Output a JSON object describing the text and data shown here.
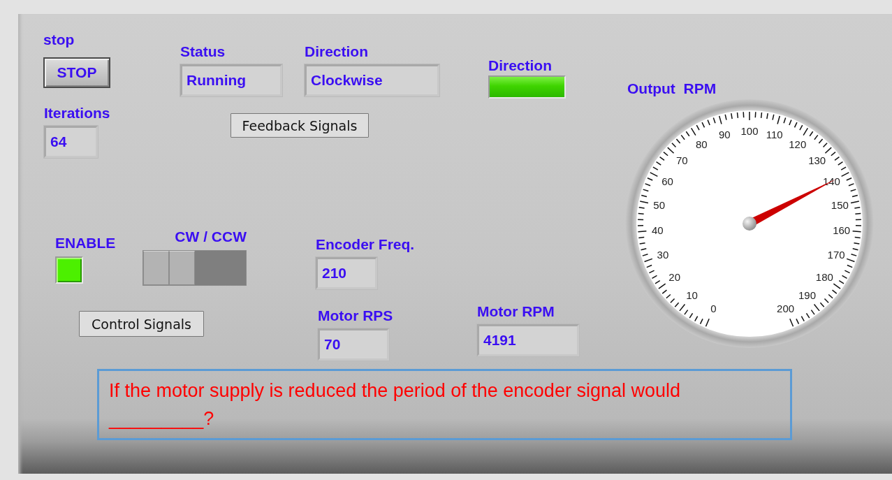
{
  "stop": {
    "label": "stop",
    "button": "STOP"
  },
  "iterations": {
    "label": "Iterations",
    "value": "64"
  },
  "status": {
    "label": "Status",
    "value": "Running"
  },
  "direction": {
    "label": "Direction",
    "value": "Clockwise"
  },
  "feedback_button": "Feedback Signals",
  "direction_led": {
    "label": "Direction",
    "on": true
  },
  "output_rpm": {
    "label": "Output  RPM",
    "scale": [
      "0",
      "10",
      "20",
      "30",
      "40",
      "50",
      "60",
      "70",
      "80",
      "90",
      "100",
      "110",
      "120",
      "130",
      "140",
      "150",
      "160",
      "170",
      "180",
      "190",
      "200"
    ],
    "level": 0.7
  },
  "enable": {
    "label": "ENABLE",
    "on": true
  },
  "cw_ccw": {
    "label": "CW / CCW",
    "on": false
  },
  "encoder_freq": {
    "label": "Encoder Freq.",
    "value": "210"
  },
  "motor_rps": {
    "label": "Motor RPS",
    "value": "70"
  },
  "motor_rpm": {
    "label": "Motor RPM",
    "value": "4191"
  },
  "control_button": "Control Signals",
  "question": "If the motor supply is reduced the period of the encoder signal would  _________?"
}
